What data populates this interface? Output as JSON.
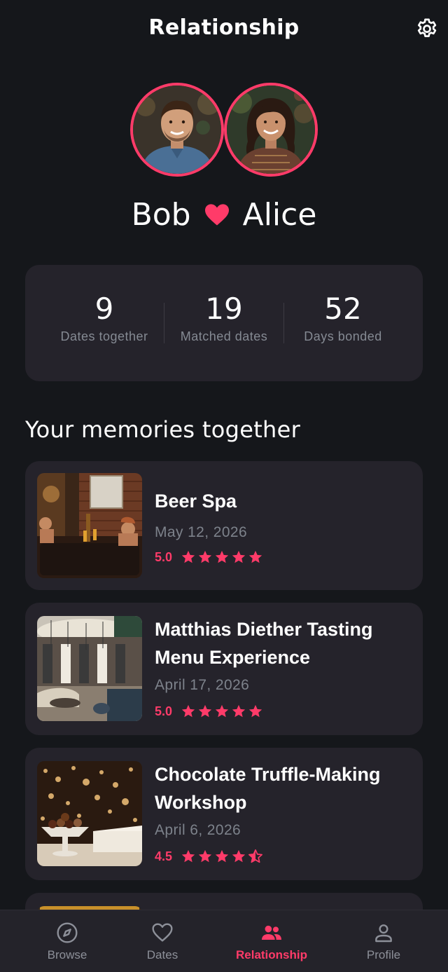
{
  "header": {
    "title": "Relationship",
    "settings_icon": "gear-icon"
  },
  "couple": {
    "partner_one": "Bob",
    "partner_two": "Alice",
    "heart_icon": "heart-icon",
    "accent_color": "#ff3b69"
  },
  "stats": [
    {
      "value": "9",
      "label": "Dates together"
    },
    {
      "value": "19",
      "label": "Matched dates"
    },
    {
      "value": "52",
      "label": "Days bonded"
    }
  ],
  "memories": {
    "title": "Your memories together",
    "items": [
      {
        "title": "Beer Spa",
        "date": "May 12, 2026",
        "rating_text": "5.0",
        "rating": 5.0
      },
      {
        "title": "Matthias Diether Tasting Menu Experience",
        "date": "April 17, 2026",
        "rating_text": "5.0",
        "rating": 5.0
      },
      {
        "title": "Chocolate Truffle-Making Workshop",
        "date": "April 6, 2026",
        "rating_text": "4.5",
        "rating": 4.5
      }
    ]
  },
  "nav": {
    "items": [
      {
        "label": "Browse",
        "icon": "compass-icon"
      },
      {
        "label": "Dates",
        "icon": "heart-outline-icon"
      },
      {
        "label": "Relationship",
        "icon": "people-icon",
        "active": true
      },
      {
        "label": "Profile",
        "icon": "person-icon"
      }
    ]
  }
}
